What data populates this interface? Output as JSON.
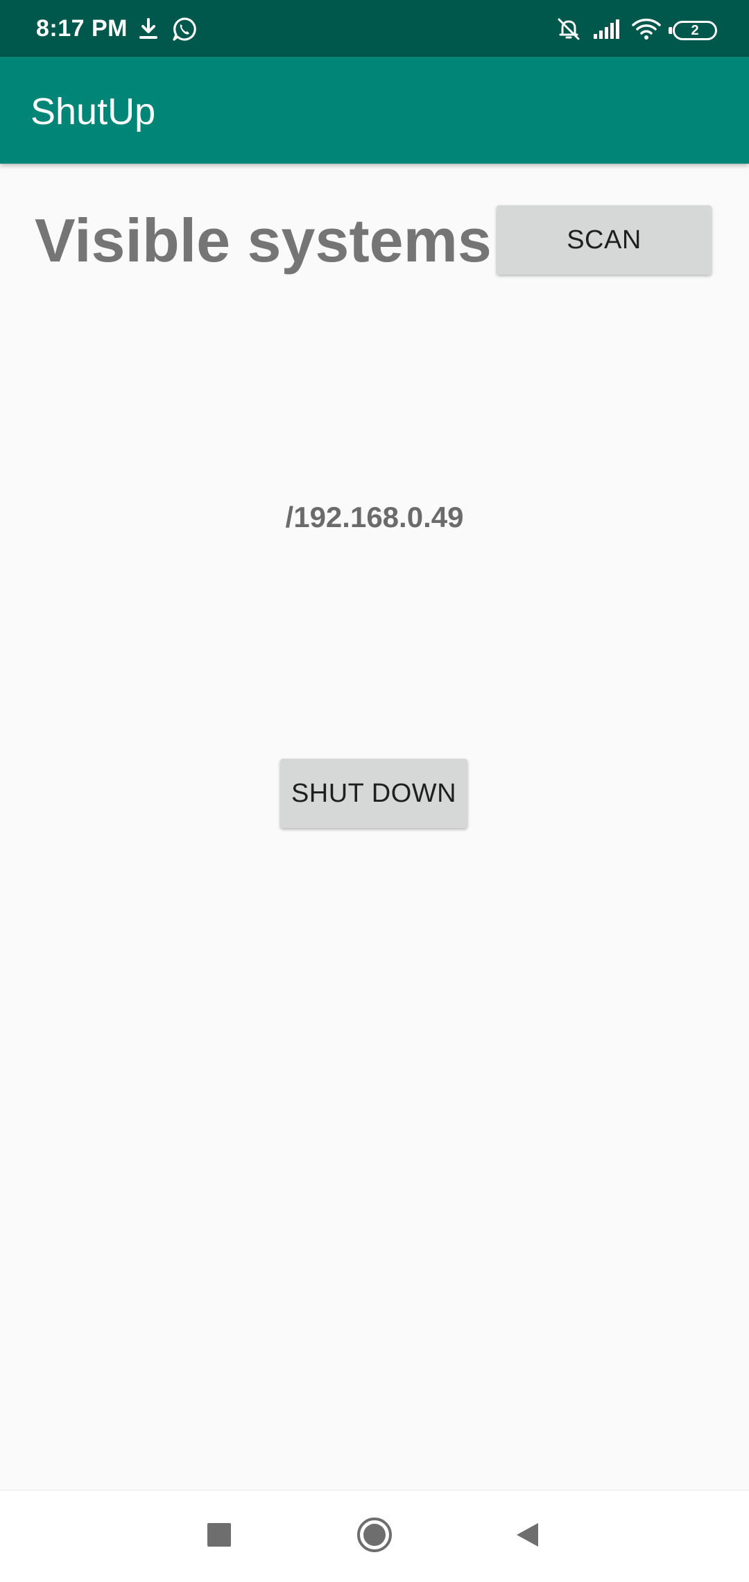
{
  "status_bar": {
    "time": "8:17 PM",
    "battery_level": "2",
    "left_icons": [
      "download-icon",
      "whatsapp-icon"
    ],
    "right_icons": [
      "notifications-muted-icon",
      "signal-icon",
      "wifi-icon",
      "battery-icon"
    ]
  },
  "app_bar": {
    "title": "ShutUp",
    "color": "#008577",
    "status_color": "#00574b"
  },
  "main": {
    "heading": "Visible systems",
    "scan_label": "SCAN",
    "systems": [
      "/192.168.0.49"
    ],
    "shutdown_label": "SHUT DOWN"
  },
  "nav_bar": {
    "buttons": [
      "recent-apps-icon",
      "home-icon",
      "back-icon"
    ]
  }
}
